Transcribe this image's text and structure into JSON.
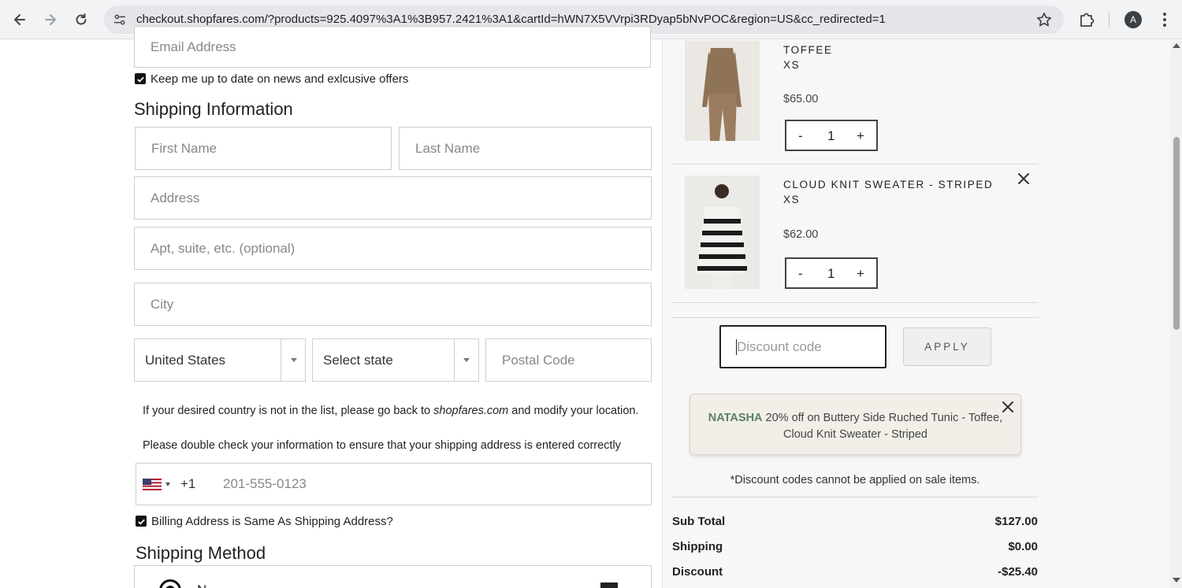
{
  "browser": {
    "url": "checkout.shopfares.com/?products=925.4097%3A1%3B957.2421%3A1&cartId=hWN7X5VVrpi3RDyap5bNvPOC&region=US&cc_redirected=1",
    "profile_initial": "A",
    "icons": [
      "back-arrow-icon",
      "forward-arrow-icon",
      "reload-icon",
      "site-info-icon",
      "bookmark-star-icon",
      "extensions-icon",
      "kebab-menu-icon"
    ]
  },
  "form": {
    "email_placeholder": "Email Address",
    "newsletter_label": "Keep me up to date on news and exlcusive offers",
    "newsletter_checked": true,
    "shipping_heading": "Shipping Information",
    "first_name_placeholder": "First Name",
    "last_name_placeholder": "Last Name",
    "address_placeholder": "Address",
    "apt_placeholder": "Apt, suite, etc. (optional)",
    "city_placeholder": "City",
    "country_value": "United States",
    "state_value": "Select state",
    "postal_placeholder": "Postal Code",
    "country_note_before": "If your desired country is not in the list, please go back to ",
    "country_note_site": "shopfares.com",
    "country_note_after": " and modify your location.",
    "double_check_note": "Please double check your information to ensure that your shipping address is entered correctly",
    "phone_country_code": "+1",
    "phone_placeholder": "201-555-0123",
    "billing_same_label": "Billing Address is Same As Shipping Address?",
    "billing_same_checked": true,
    "shipping_method_heading": "Shipping Method",
    "shipping_option_partial": "N"
  },
  "cart": {
    "items": [
      {
        "name": "TOFFEE",
        "size": "XS",
        "price": "$65.00",
        "qty": "1",
        "minus": "-",
        "plus": "+"
      },
      {
        "name": "CLOUD KNIT SWEATER - STRIPED",
        "size": "XS",
        "price": "$62.00",
        "qty": "1",
        "minus": "-",
        "plus": "+"
      }
    ],
    "discount_placeholder": "Discount code",
    "apply_label": "APPLY",
    "promo_code": "NATASHA",
    "promo_text": " 20% off on Buttery Side Ruched Tunic - Toffee, Cloud Knit Sweater - Striped",
    "discount_note": "*Discount codes cannot be applied on sale items.",
    "summary": [
      {
        "label": "Sub Total",
        "value": "$127.00"
      },
      {
        "label": "Shipping",
        "value": "$0.00"
      },
      {
        "label": "Discount",
        "value": "-$25.40"
      }
    ]
  },
  "colors": {
    "promo_code": "#5a7f6b",
    "cart_background": "#f7f7f7",
    "promo_background": "#f1efe8"
  }
}
